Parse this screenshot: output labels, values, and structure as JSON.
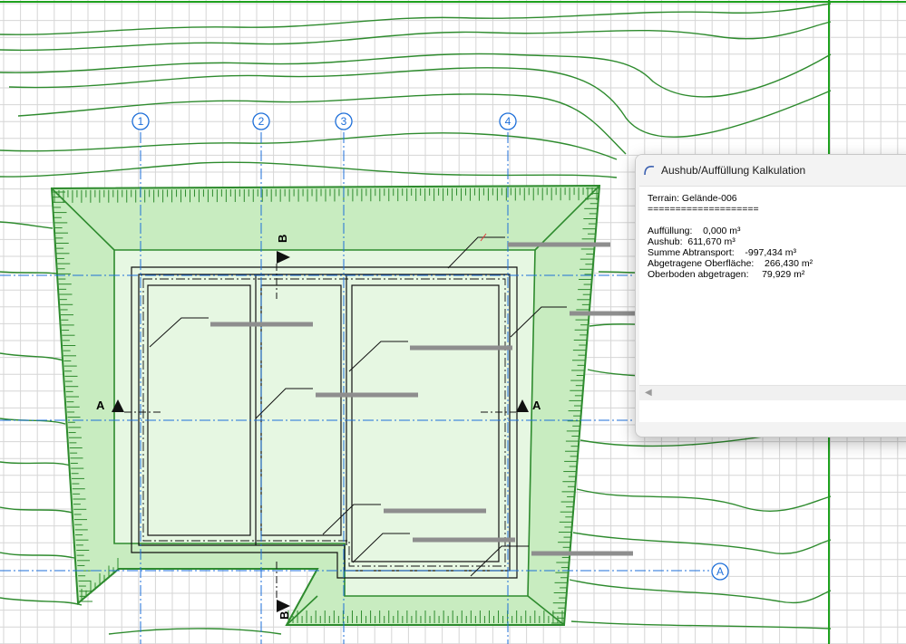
{
  "drawing": {
    "axes": [
      {
        "label": "1"
      },
      {
        "label": "2"
      },
      {
        "label": "3"
      },
      {
        "label": "4"
      },
      {
        "label": "A"
      }
    ],
    "section_marks": {
      "a_left": "A",
      "a_right": "A",
      "b_top": "B",
      "b_bottom": "B"
    },
    "colors": {
      "contour": "#2e8b2e",
      "excavation_fill": "#c8ecc0",
      "excavation_inner": "#e6f7e2",
      "grid": "#d6d6d6",
      "axis": "#1e6fd9"
    }
  },
  "dialog": {
    "title": "Aushub/Auffüllung Kalkulation",
    "icon": "arc-icon",
    "lines": [
      "Terrain: Gelände-006",
      "====================",
      "",
      "Auffüllung:    0,000 m³",
      "Aushub:  611,670 m³",
      "Summe Abtransport:    -997,434 m³",
      "Abgetragene Oberfläche:    266,430 m²",
      "Oberboden abgetragen:     79,929 m²"
    ]
  }
}
